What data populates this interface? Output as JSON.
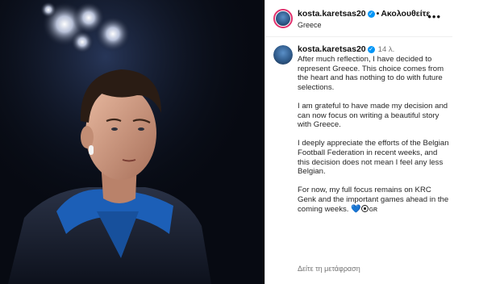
{
  "header": {
    "username": "kosta.karetsas20",
    "verified_glyph": "✓",
    "separator": "•",
    "follow_label": "Ακολουθείτε",
    "location": "Greece",
    "more_label": "•••"
  },
  "comment": {
    "username": "kosta.karetsas20",
    "verified_glyph": "✓",
    "time": "14 λ.",
    "paragraphs": [
      "After much reflection, I have decided to represent Greece. This choice comes from the heart and has nothing to do with future selections.",
      "I am grateful to have made my decision and can now focus on writing a beautiful story with Greece.",
      "I deeply appreciate the efforts of the Belgian Football Federation in recent weeks, and this decision does not mean I feel any less Belgian.",
      "For now, my full focus remains on KRC Genk and the important games ahead in the coming weeks."
    ],
    "emoji_heart": "💙",
    "emoji_flag_text": "GR",
    "translate_label": "Δείτε τη μετάφραση"
  },
  "icons": {
    "avatar": "profile-avatar-icon",
    "verified": "verified-badge-icon",
    "more": "more-options-icon",
    "heart": "blue-heart-icon",
    "ball": "soccer-ball-icon",
    "flag": "greece-flag-icon"
  },
  "colors": {
    "verified_blue": "#0095f6",
    "story_ring": "#e1306c",
    "muted_text": "#737373",
    "photo_background": "#070a12",
    "jacket_blue": "#1c5fb7"
  }
}
